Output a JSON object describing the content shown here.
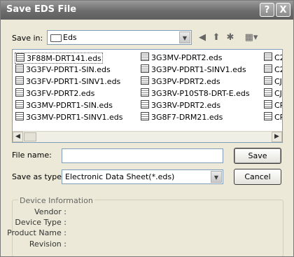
{
  "window": {
    "title": "Save EDS File"
  },
  "titlebar_buttons": {
    "help": "?",
    "close": "X"
  },
  "save_in": {
    "label": "Save in:",
    "value": "Eds"
  },
  "nav_icons": [
    "back-icon",
    "up-folder-icon",
    "new-folder-icon",
    "view-menu-icon"
  ],
  "files": [
    [
      "3F88M-DRT141.eds",
      "3G3FV-PDRT1-SIN.eds",
      "3G3FV-PDRT1-SINV1.eds",
      "3G3FV-PDRT2.eds",
      "3G3MV-PDRT1-SIN.eds",
      "3G3MV-PDRT1-SINV1.eds"
    ],
    [
      "3G3MV-PDRT2.eds",
      "3G3PV-PDRT1-SINV1.eds",
      "3G3PV-PDRT2.eds",
      "3G3RV-P10ST8-DRT-E.eds",
      "3G3RV-PDRT2.eds",
      "3G8F7-DRM21.eds"
    ],
    [
      "C2",
      "C2",
      "CJ",
      "CJ",
      "CP",
      "CP"
    ]
  ],
  "file_name": {
    "label": "File name:",
    "value": ""
  },
  "save_as_type": {
    "label": "Save as type:",
    "value": "Electronic Data Sheet(*.eds)"
  },
  "buttons": {
    "save": "Save",
    "cancel": "Cancel"
  },
  "device_info": {
    "title": "Device Information",
    "vendor": "Vendor :",
    "device_type": "Device Type :",
    "product_name": "Product Name :",
    "revision": "Revision :"
  }
}
